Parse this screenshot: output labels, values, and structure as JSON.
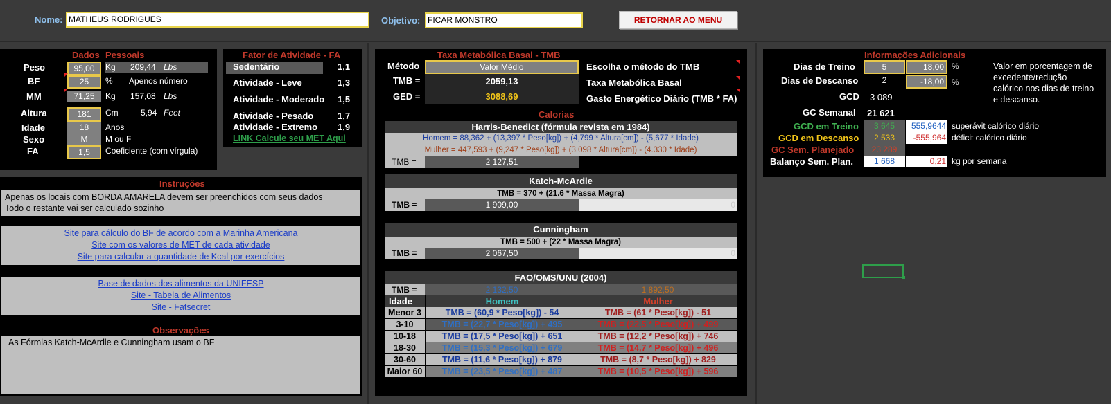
{
  "header": {
    "nome_label": "Nome:",
    "nome_value": "MATHEUS RODRIGUES",
    "objetivo_label": "Objetivo:",
    "objetivo_value": "FICAR MONSTRO",
    "menu_button": "RETORNAR AO MENU"
  },
  "dados": {
    "title_a": "Dados",
    "title_b": "Pessoais",
    "rows": [
      {
        "label": "Peso",
        "value": "95,00",
        "unit": "Kg",
        "alt": "209,44",
        "alt_unit": "Lbs"
      },
      {
        "label": "BF",
        "value": "25",
        "unit": "%",
        "alt": "Apenos número",
        "alt_unit": ""
      },
      {
        "label": "MM",
        "value": "71,25",
        "unit": "Kg",
        "alt": "157,08",
        "alt_unit": "Lbs"
      },
      {
        "label": "Altura",
        "value": "181",
        "unit": "Cm",
        "alt": "5,94",
        "alt_unit": "Feet"
      },
      {
        "label": "Idade",
        "value": "18",
        "unit": "Anos",
        "alt": "",
        "alt_unit": ""
      },
      {
        "label": "Sexo",
        "value": "M",
        "unit": "M ou F",
        "alt": "",
        "alt_unit": ""
      },
      {
        "label": "FA",
        "value": "1,5",
        "unit": "Coeficiente (com vírgula)",
        "alt": "",
        "alt_unit": ""
      }
    ]
  },
  "fator": {
    "title": "Fator de Atividade - FA",
    "rows": [
      {
        "label": "Sedentário",
        "value": "1,1"
      },
      {
        "label": "Atividade - Leve",
        "value": "1,3"
      },
      {
        "label": "Atividade - Moderado",
        "value": "1,5"
      },
      {
        "label": "Atividade - Pesado",
        "value": "1,7"
      },
      {
        "label": "Atividade - Extremo",
        "value": "1,9"
      }
    ],
    "link": "LINK Calcule seu MET Aqui"
  },
  "instrucoes": {
    "title": "Instruções",
    "line1": "Apenas os locais com BORDA AMARELA devem ser preenchidos com seus dados",
    "line2": "Todo o restante vai ser calculado sozinho"
  },
  "links1": [
    "Site para cálculo do BF de acordo com a Marinha Americana",
    "Site com os valores de MET de cada atividade",
    "Site para calcular a quantidade de Kcal por exercícios"
  ],
  "links2": [
    "Base de dados dos alimentos da UNIFESP",
    "Site - Tabela de Alimentos",
    "Site - Fatsecret"
  ],
  "observacoes": {
    "title": "Observações",
    "text": "As Fórmlas Katch-McArdle e Cunningham usam o BF"
  },
  "tmb": {
    "title": "Taxa Metabólica Basal - TMB",
    "metodo_label": "Método",
    "metodo_value": "Valor Médio",
    "metodo_desc": "Escolha o método do TMB",
    "tmb_label": "TMB =",
    "tmb_value": "2059,13",
    "tmb_desc": "Taxa Metabólica Basal",
    "ged_label": "GED =",
    "ged_value": "3088,69",
    "ged_desc": "Gasto Energético Diário (TMB * FA)"
  },
  "calorias": {
    "title": "Calorias",
    "harris": {
      "title": "Harris-Benedict (fórmula revista em 1984)",
      "homem": "Homem = 88,362 + (13,397 * Peso[kg]) + (4,799 * Altura[cm]) - (5,677 * Idade)",
      "mulher": "Mulher = 447,593 + (9,247 * Peso[kg]) + (3.098 * Altura[cm]) - (4.330 * Idade)",
      "tmb_label": "TMB =",
      "tmb_value": "2 127,51"
    },
    "katch": {
      "title": "Katch-McArdle",
      "formula": "TMB = 370 + (21.6 * Massa Magra)",
      "tmb_label": "TMB =",
      "tmb_value": "1 909,00",
      "extra": "0"
    },
    "cunningham": {
      "title": "Cunningham",
      "formula": "TMB = 500 + (22 * Massa Magra)",
      "tmb_label": "TMB =",
      "tmb_value": "2 067,50",
      "extra": "0"
    },
    "fao": {
      "title": "FAO/OMS/UNU (2004)",
      "tmb_label": "TMB =",
      "homem_value": "2 132,50",
      "mulher_value": "1 892,50",
      "col_idade": "Idade",
      "col_homem": "Homem",
      "col_mulher": "Mulher",
      "rows": [
        {
          "idade": "Menor 3",
          "homem": "TMB = (60,9 * Peso[kg]) - 54",
          "mulher": "TMB = (61 * Peso[kg]) - 51"
        },
        {
          "idade": "3-10",
          "homem": "TMB = (22,7 * Peso[kg]) + 495",
          "mulher": "TMB = (22,5 * Peso[kg]) + 499"
        },
        {
          "idade": "10-18",
          "homem": "TMB = (17,5 * Peso[kg]) + 651",
          "mulher": "TMB = (12,2 * Peso[kg]) + 746"
        },
        {
          "idade": "18-30",
          "homem": "TMB = (15,3 * Peso[kg]) + 679",
          "mulher": "TMB = (14,7 * Peso[kg]) + 496"
        },
        {
          "idade": "30-60",
          "homem": "TMB = (11,6 * Peso[kg]) + 879",
          "mulher": "TMB = (8,7 * Peso[kg]) + 829"
        },
        {
          "idade": "Maior 60",
          "homem": "TMB = (23,5 * Peso[kg]) + 487",
          "mulher": "TMB = (10,5 * Peso[kg]) + 596"
        }
      ]
    }
  },
  "info": {
    "title": "Informações Adicionais",
    "dias_treino_label": "Dias de Treino",
    "dias_treino_value": "5",
    "dias_treino_pct": "18,00",
    "dias_descanso_label": "Dias de Descanso",
    "dias_descanso_value": "2",
    "dias_descanso_pct": "-18,00",
    "pct_sign": "%",
    "note": "Valor em porcentagem de excedente/redução calórico nos dias de treino e descanso.",
    "gcd_label": "GCD",
    "gcd_value": "3 089",
    "gc_semanal_label": "GC Semanal",
    "gc_semanal_value": "21 621",
    "gcd_treino_label": "GCD em Treino",
    "gcd_treino_value": "3 645",
    "gcd_treino_diff": "555,9644",
    "gcd_treino_desc": "superávit calórico diário",
    "gcd_descanso_label": "GCD em Descanso",
    "gcd_descanso_value": "2 533",
    "gcd_descanso_diff": "-555,964",
    "gcd_descanso_desc": "déficit calórico diário",
    "gc_plan_label": "GC Sem. Planejado",
    "gc_plan_value": "23 289",
    "balanco_label": "Balanço Sem. Plan.",
    "balanco_value": "1 668",
    "balanco_kg": "0,21",
    "balanco_desc": "kg por semana"
  },
  "colors": {
    "accent_red": "#c0392b",
    "yellow_border": "#e8d44a",
    "link_blue": "#1a3cc8",
    "green": "#4caf50"
  }
}
